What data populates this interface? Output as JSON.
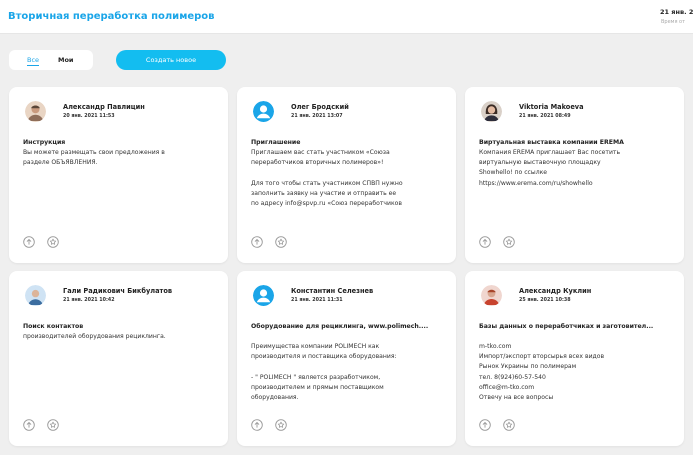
{
  "app": {
    "title": "Вторичная переработка полимеров"
  },
  "header": {
    "date": "21 янв. 2",
    "subtitle": "Время от"
  },
  "filter": {
    "tabs": [
      {
        "label": "Все"
      },
      {
        "label": "Мои"
      }
    ]
  },
  "create_button": {
    "label": "Создать новое"
  },
  "colors": {
    "accent": "#1aa5e8",
    "button": "#13bdf0"
  },
  "cards": [
    {
      "author": "Александр Павлицин",
      "date": "20 янв. 2021 11:53",
      "avatar": "photo",
      "title": "Инструкция",
      "body": [
        "Вы можете размещать свои предложения в",
        "разделе ОБЪЯВЛЕНИЯ."
      ]
    },
    {
      "author": "Олег Бродский",
      "date": "21 янв. 2021 13:07",
      "avatar": "user-icon",
      "title": "Приглашение",
      "body": [
        "Приглашаем вас стать участником «Союза",
        "переработчиков вторичных полимеров»!",
        "",
        "Для того чтобы стать участником СПВП нужно",
        "заполнить заявку на участие и отправить ее",
        "по адресу info@spvp.ru «Союз переработчиков"
      ]
    },
    {
      "author": "Viktoria Makoeva",
      "date": "21 янв. 2021 08:49",
      "avatar": "photo",
      "title": "Виртуальная выставка компании EREMA",
      "body": [
        "Компания EREMA приглашает Вас посетить",
        "виртуальную выставочную площадку",
        "Showhello! по ссылке",
        "https://www.erema.com/ru/showhello"
      ]
    },
    {
      "author": "Гали Радикович Бикбулатов",
      "date": "21 янв. 2021 10:42",
      "avatar": "photo",
      "title": "Поиск контактов",
      "body": [
        "производителей оборудования рециклинга."
      ]
    },
    {
      "author": "Константин Селезнев",
      "date": "21 янв. 2021 11:31",
      "avatar": "user-icon",
      "title": "Оборудование для рециклинга, www.polimech....",
      "body": [
        "Преимущества компании POLIMECH как",
        "производителя и поставщика оборудования:",
        "",
        "- \" POLIMECH \" является разработчиком,",
        "производителем и прямым поставщиком",
        "оборудования."
      ]
    },
    {
      "author": "Александр Куклин",
      "date": "25 янв. 2021 10:38",
      "avatar": "photo",
      "title": "Базы данных о переработчиках и заготовител...",
      "body": [
        "m-tko.com",
        "Импорт/экспорт вторсырья всех видов",
        "Рынок Украины по полимерам",
        "тел. 8(924)60-57-540",
        "office@m-tko.com",
        "Отвечу на все вопросы"
      ]
    }
  ]
}
